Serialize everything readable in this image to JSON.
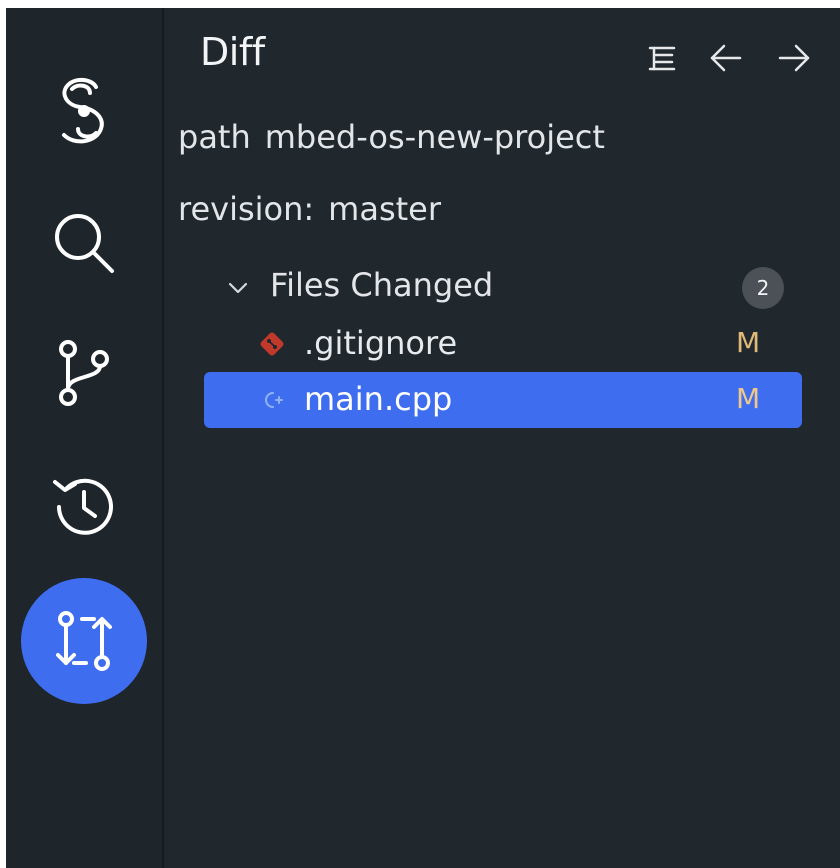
{
  "activity_bar": {
    "items": [
      {
        "name": "logo",
        "icon": "spiral-logo-icon",
        "active": false
      },
      {
        "name": "search",
        "icon": "search-icon",
        "active": false
      },
      {
        "name": "source-control",
        "icon": "git-branch-icon",
        "active": false
      },
      {
        "name": "history",
        "icon": "history-icon",
        "active": false
      },
      {
        "name": "diff",
        "icon": "git-compare-icon",
        "active": true
      }
    ]
  },
  "panel": {
    "title": "Diff",
    "toolbar": {
      "tree_view_icon": "tree-view-icon",
      "back_icon": "arrow-left-icon",
      "forward_icon": "arrow-right-icon"
    },
    "path": {
      "label": "path",
      "value": "mbed-os-new-project"
    },
    "revision": {
      "label": "revision:",
      "value": "master"
    },
    "group": {
      "label": "Files Changed",
      "count": "2",
      "expanded": true,
      "files": [
        {
          "name": ".gitignore",
          "status": "M",
          "icon": "git-file-icon",
          "selected": false
        },
        {
          "name": "main.cpp",
          "status": "M",
          "icon": "cpp-file-icon",
          "selected": true
        }
      ]
    }
  },
  "colors": {
    "background": "#20272d",
    "activity_bar": "#1e252b",
    "accent": "#3f6df0",
    "badge": "#4b5157",
    "modified": "#e0b978",
    "git_icon": "#c0392b"
  }
}
